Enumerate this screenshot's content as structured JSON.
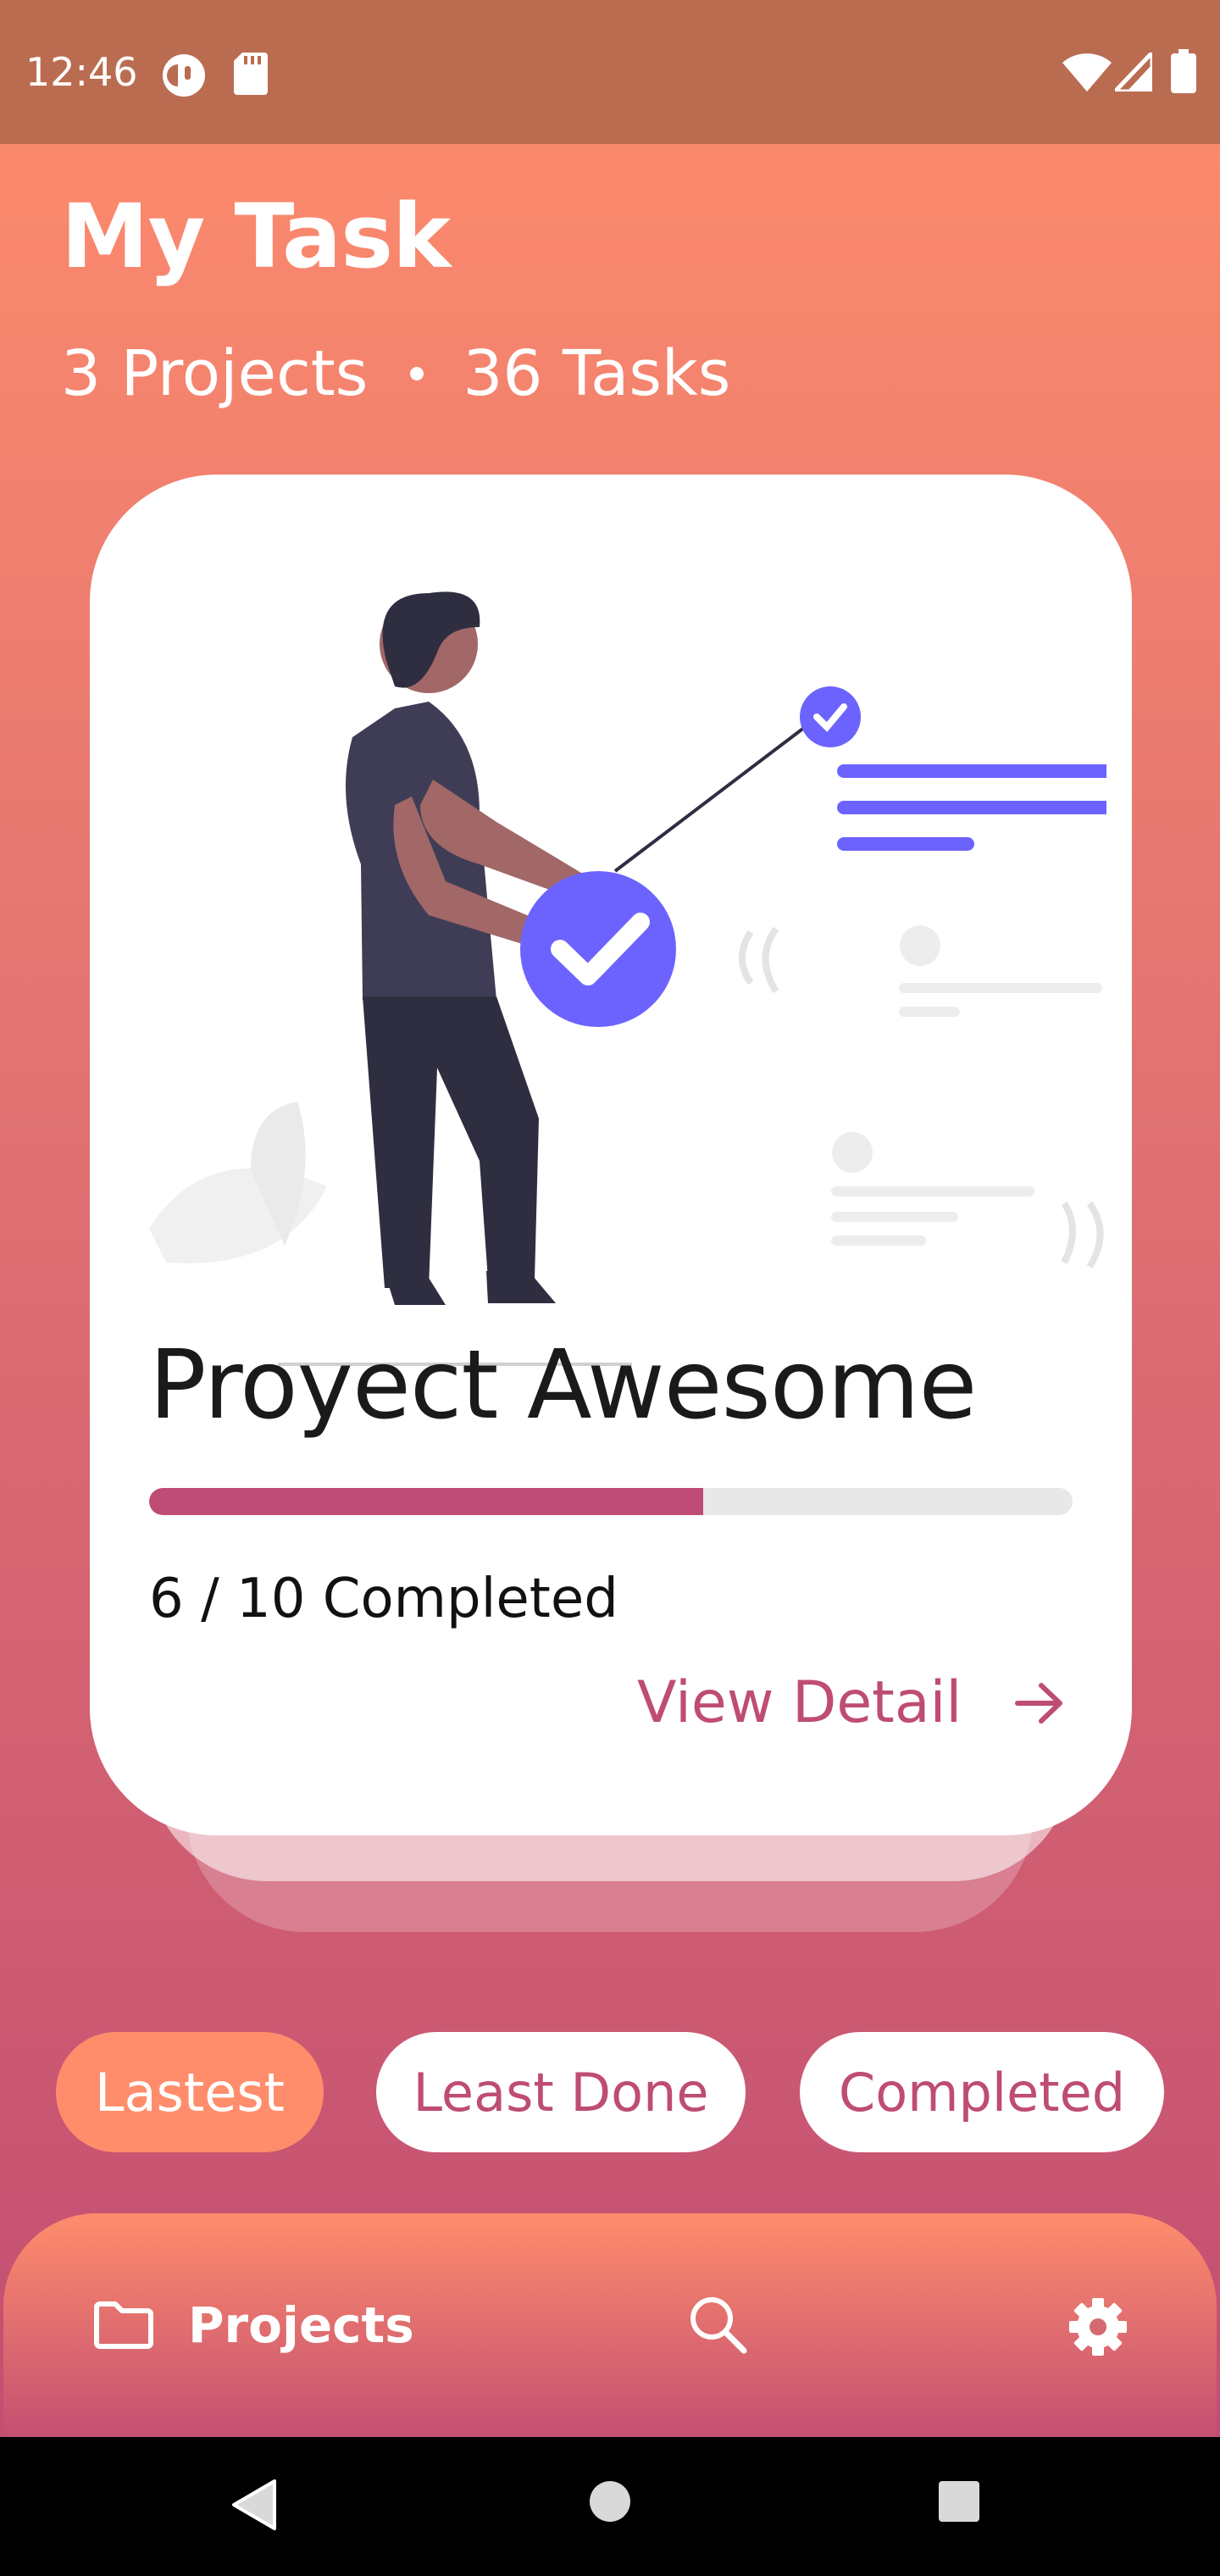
{
  "status_bar": {
    "time": "12:46"
  },
  "header": {
    "title": "My Task",
    "projects_count": "3 Projects",
    "tasks_count": "36 Tasks"
  },
  "project_card": {
    "name": "Proyect Awesome",
    "completed": 6,
    "total": 10,
    "progress_fraction": 0.6,
    "progress_text": "6 / 10 Completed",
    "view_detail_label": "View Detail"
  },
  "filters": {
    "items": [
      {
        "label": "Lastest",
        "selected": true
      },
      {
        "label": "Least Done",
        "selected": false
      },
      {
        "label": "Completed",
        "selected": false
      }
    ]
  },
  "bottom_nav": {
    "projects_label": "Projects",
    "icons": [
      "folder-icon",
      "search-icon",
      "gear-icon"
    ]
  },
  "colors": {
    "accent": "#BE4C74",
    "chip_active": "#FF8D6C",
    "illustration_accent": "#6C63FF"
  }
}
